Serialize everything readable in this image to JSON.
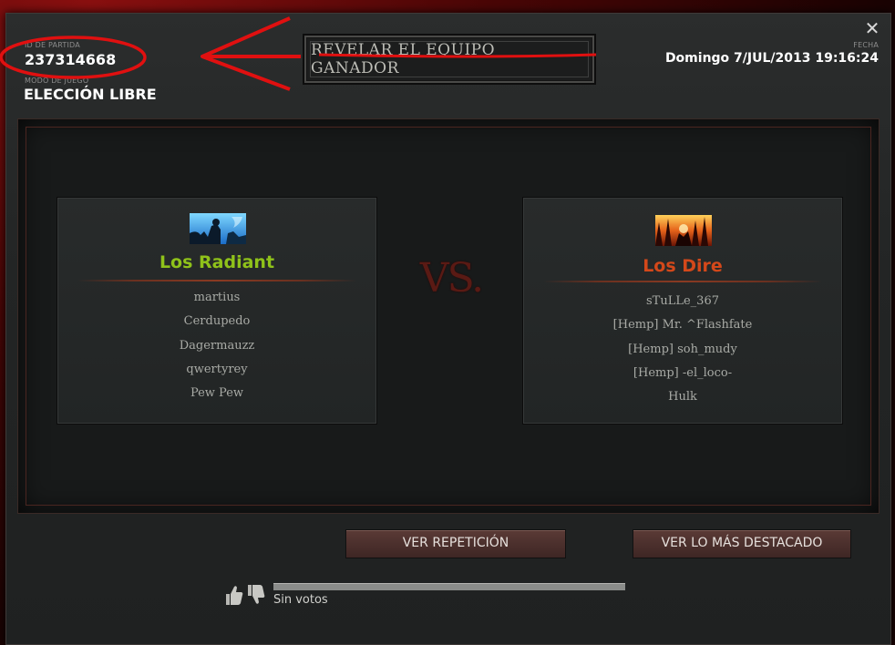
{
  "header": {
    "match_id_label": "ID DE PARTIDA",
    "match_id": "237314668",
    "game_mode_label": "MODO DE JUEGO",
    "game_mode": "ELECCIÓN LIBRE",
    "reveal_button": "REVELAR EL EQUIPO GANADOR",
    "date_label": "FECHA",
    "date": "Domingo 7/JUL/2013 19:16:24",
    "close_icon": "close-icon"
  },
  "radiant": {
    "name": "Los Radiant",
    "color": "#8fc21a",
    "icon": "radiant-icon",
    "players": [
      "martius",
      "Cerdupedo",
      "Dagermauzz",
      "qwertyrey",
      "Pew Pew"
    ]
  },
  "vs": "VS.",
  "dire": {
    "name": "Los Dire",
    "color": "#d4481a",
    "icon": "dire-icon",
    "players": [
      "sTuLLe_367",
      "[Hemp] Mr. ^Flashfate",
      "[Hemp] soh_mudy",
      "[Hemp] -el_loco-",
      "Hulk"
    ]
  },
  "actions": {
    "watch_replay": "VER REPETICIÓN",
    "watch_highlights": "VER LO MÁS DESTACADO"
  },
  "votes": {
    "status": "Sin votos",
    "thumbs_up_icon": "thumbs-up-icon",
    "thumbs_down_icon": "thumbs-down-icon"
  },
  "annotation_color": "#e01010"
}
